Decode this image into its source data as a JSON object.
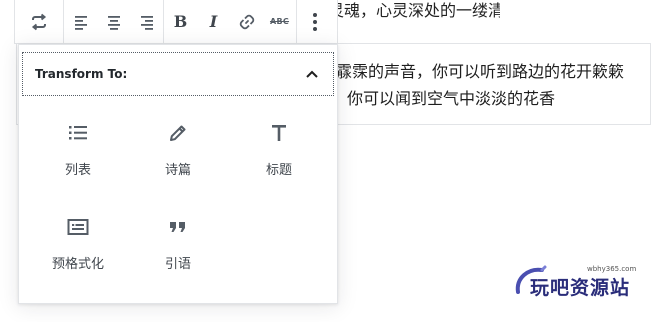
{
  "background": {
    "top_line": "着一缕缕清香，只要心中有诗，花也有了灵魂，心灵深处的一缕清音",
    "block_line1": "霡霂的声音，你可以听到路边的花开簌簌",
    "block_line2": "你可以闻到空气中淡淡的花香"
  },
  "toolbar": {
    "bold_label": "B",
    "italic_label": "I",
    "strike_label": "ABC"
  },
  "popover": {
    "title": "Transform To:",
    "items": [
      {
        "label": "列表",
        "icon": "list-icon"
      },
      {
        "label": "诗篇",
        "icon": "pencil-icon"
      },
      {
        "label": "标题",
        "icon": "heading-icon"
      },
      {
        "label": "预格式化",
        "icon": "preformatted-icon"
      },
      {
        "label": "引语",
        "icon": "quote-icon"
      }
    ]
  },
  "watermark": {
    "url": "wbhy365.com",
    "text": "玩吧资源站"
  },
  "colors": {
    "icon": "#555d66",
    "border": "#e2e4e7",
    "watermark": "#2a2d7a"
  }
}
